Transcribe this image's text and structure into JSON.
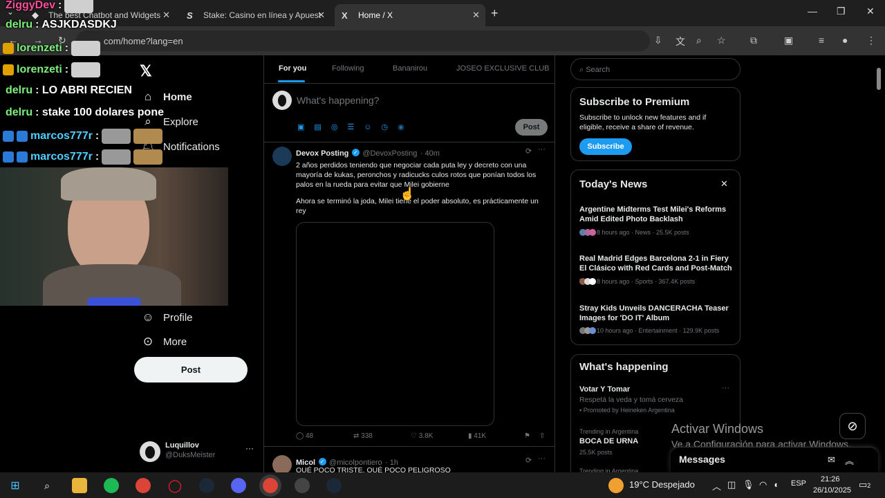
{
  "browser": {
    "tabs": [
      {
        "title": "The best Chatbot and Widgets",
        "icon": "chatbot-icon",
        "glyph": "◆"
      },
      {
        "title": "Stake: Casino en línea y Apuest",
        "icon": "stake-icon",
        "glyph": "S"
      },
      {
        "title": "Home / X",
        "icon": "x-icon",
        "glyph": "X"
      }
    ],
    "url": "com/home?lang=en"
  },
  "x": {
    "nav": {
      "home": "Home",
      "explore": "Explore",
      "notifications": "Notifications",
      "profile": "Profile",
      "more": "More",
      "post": "Post"
    },
    "account": {
      "name": "Luquillov",
      "handle": "@DuksMeister"
    },
    "feed_tabs": [
      "For you",
      "Following",
      "Bananirou",
      "JOSEO EXCLUSIVE CLUB"
    ],
    "composer": {
      "placeholder": "What's happening?",
      "post": "Post"
    },
    "tweets": [
      {
        "name": "Devox Posting",
        "handle": "@DevoxPosting",
        "time": "· 40m",
        "text1": "2 años perdidos teniendo que negociar cada puta ley y decreto con una mayoría de kukas, peronchos y radicucks culos rotos que ponían todos los palos en la rueda para evitar que Milei gobierne",
        "text2": "Ahora se terminó la joda, Milei tiene el poder absoluto, es prácticamente un rey",
        "replies": "48",
        "reposts": "338",
        "likes": "3.8K",
        "views": "41K"
      },
      {
        "name": "Micol",
        "handle": "@micolpontiero",
        "time": "· 1h",
        "text1": "QUÉ POCO TRISTE, QUÉ POCO PELIGROSO"
      }
    ],
    "search_placeholder": "Search",
    "premium": {
      "title": "Subscribe to Premium",
      "text": "Subscribe to unlock new features and if eligible, receive a share of revenue.",
      "button": "Subscribe"
    },
    "news": {
      "title": "Today's News",
      "items": [
        {
          "title": "Argentine Midterms Test Milei's Reforms Amid Edited Photo Backlash",
          "meta": "8 hours ago · News · 25.5K posts"
        },
        {
          "title": "Real Madrid Edges Barcelona 2-1 in Fiery El Clásico with Red Cards and Post-Match ...",
          "meta": "8 hours ago · Sports · 367.4K posts"
        },
        {
          "title": "Stray Kids Unveils DANCERACHA Teaser Images for 'DO IT' Album",
          "meta": "10 hours ago · Entertainment · 129.9K posts"
        }
      ]
    },
    "happening": {
      "title": "What's happening",
      "ad_title": "Votar Y Tomar",
      "ad_text": "Respetá la veda y tomá cerveza",
      "ad_promoted": "Promoted by Heineken Argentina",
      "trend_ctx": "Trending in Argentina",
      "trend_name": "BOCA DE URNA",
      "trend_posts": "25.5K posts",
      "trend_ctx2": "Trending in Argentina"
    },
    "messages": "Messages"
  },
  "overlay": {
    "chat": [
      {
        "user": "ZiggyDev",
        "msg": "",
        "color": "#ff4f9a"
      },
      {
        "user": "delru",
        "msg": "ASJKDASDKJ",
        "color": "#7cf07c"
      },
      {
        "user": "lorenzeti",
        "msg": "",
        "color": "#7cf07c"
      },
      {
        "user": "lorenzeti",
        "msg": "",
        "color": "#7cf07c"
      },
      {
        "user": "delru",
        "msg": "LO ABRI RECIEN",
        "color": "#7cf07c"
      },
      {
        "user": "delru",
        "msg": "stake 100 dolares pone",
        "color": "#7cf07c"
      },
      {
        "user": "marcos777r",
        "msg": "",
        "color": "#4fd0ff"
      },
      {
        "user": "marcos777r",
        "msg": "",
        "color": "#4fd0ff"
      }
    ],
    "sep": ":"
  },
  "windows": {
    "watermark_title": "Activar Windows",
    "watermark_text": "Ve a Configuración para activar Windows.",
    "weather": "19°C  Despejado",
    "lang": "ESP",
    "time": "21:26",
    "date": "26/10/2025",
    "notif_count": "2"
  }
}
